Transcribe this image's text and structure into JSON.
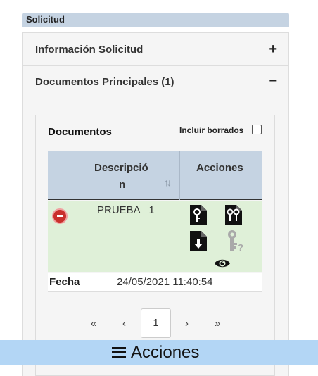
{
  "section": {
    "label": "Solicitud"
  },
  "rows": [
    {
      "title": "Información Solicitud",
      "toggle": "+"
    },
    {
      "title": "Documentos Principales (1)",
      "toggle": "−"
    }
  ],
  "documents": {
    "title": "Documentos",
    "include_deleted_label": "Incluir borrados",
    "include_deleted_checked": false,
    "columns": {
      "description_line1": "Descripció",
      "description_line2": "n",
      "actions": "Acciones"
    },
    "sort_icon": "sort-icon",
    "items": [
      {
        "description": "PRUEBA _1",
        "fecha_label": "Fecha",
        "fecha": "24/05/2021 11:40:54"
      }
    ]
  },
  "pagination": {
    "first": "«",
    "prev": "‹",
    "current": "1",
    "next": "›",
    "last": "»"
  },
  "footer": {
    "label": "Acciones"
  },
  "colors": {
    "header_bg": "#c5d3e2",
    "row_bg": "#dff0d8",
    "bar_bg": "#b3d6f5",
    "danger": "#c9302c"
  }
}
